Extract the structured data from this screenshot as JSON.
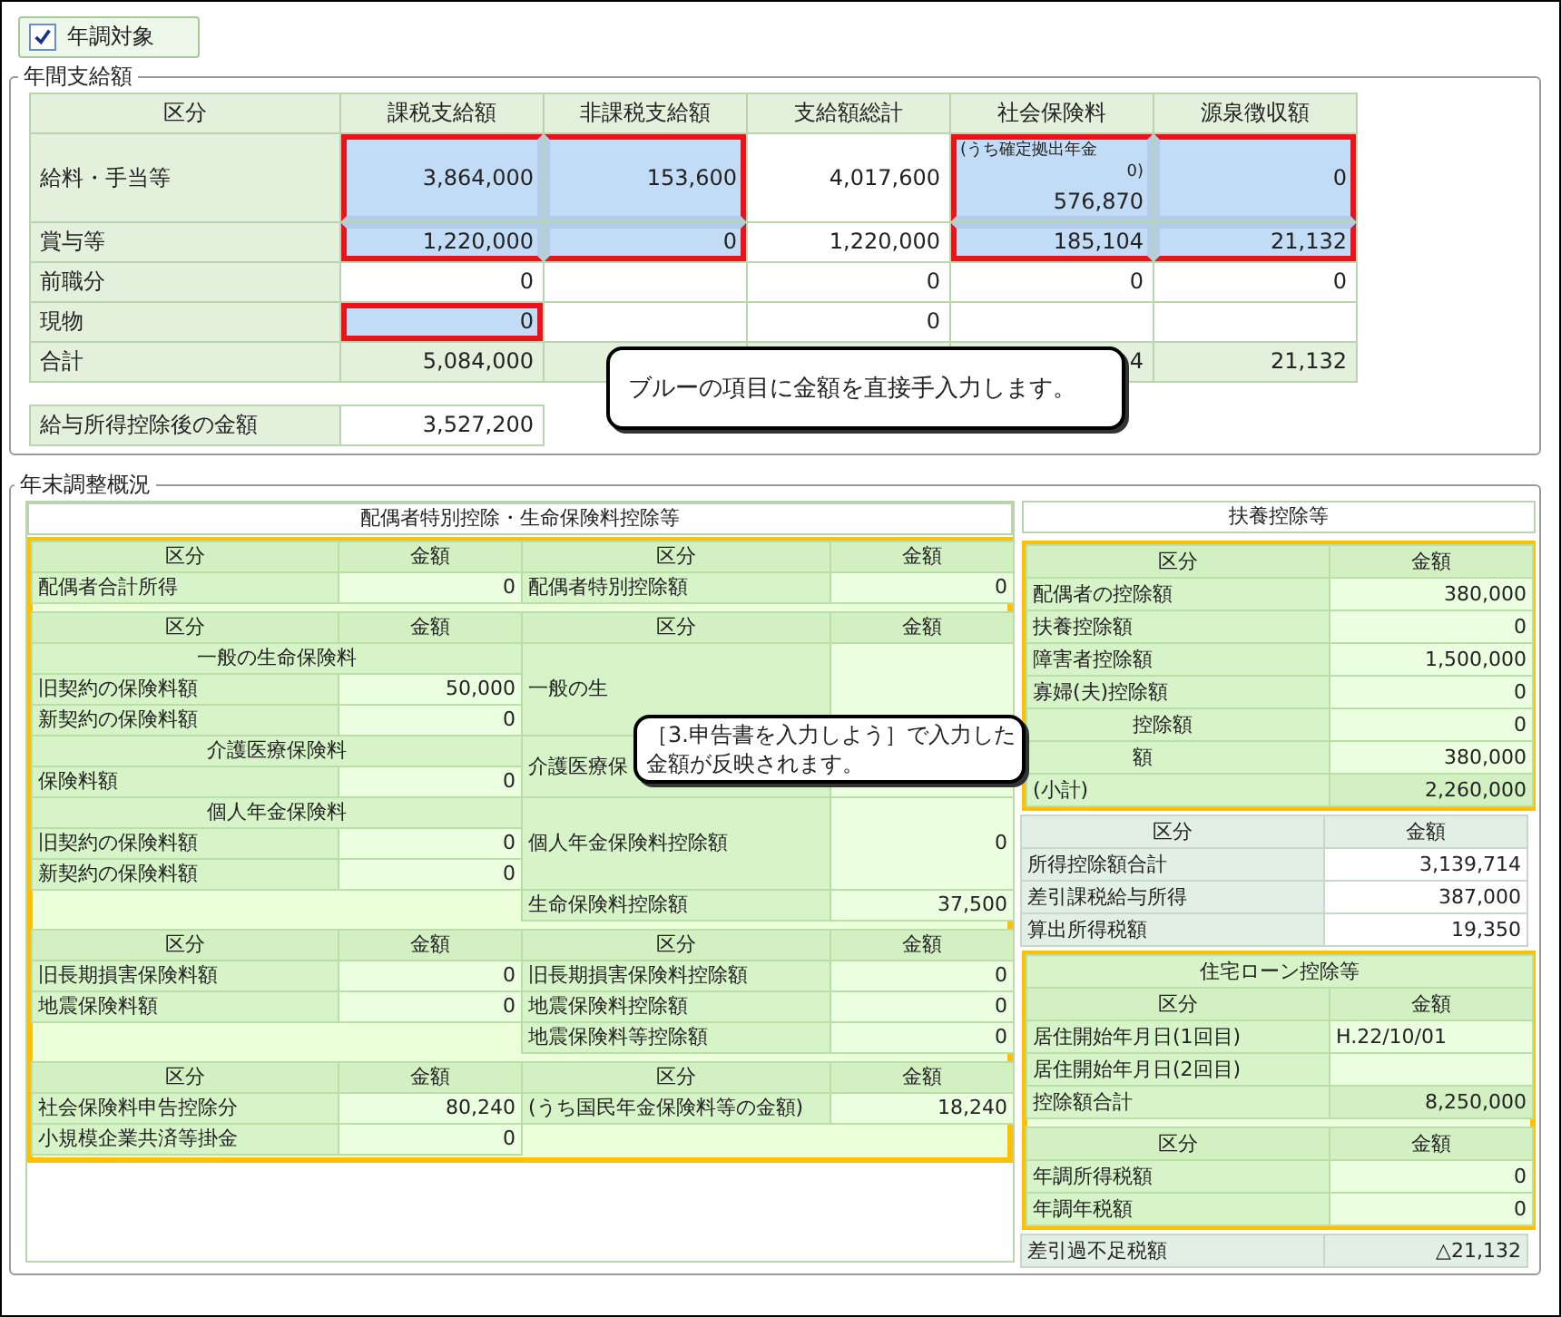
{
  "checkbox": {
    "label": "年調対象",
    "checked": true
  },
  "annual": {
    "legend": "年間支給額",
    "columns": [
      "区分",
      "課税支給額",
      "非課税支給額",
      "支給額総計",
      "社会保険料",
      "源泉徴収額"
    ],
    "rows": [
      {
        "cells": [
          {
            "value": "給料・手当等",
            "kind": "label",
            "highlight": false
          },
          {
            "value": "3,864,000",
            "kind": "input",
            "highlight": true
          },
          {
            "value": "153,600",
            "kind": "input",
            "highlight": true
          },
          {
            "value": "4,017,600",
            "kind": "plain",
            "highlight": false
          },
          {
            "value": "576,870",
            "note": [
              "(うち確定拠出年金",
              "0)"
            ],
            "kind": "input",
            "highlight": true
          },
          {
            "value": "0",
            "kind": "input",
            "highlight": true
          }
        ]
      },
      {
        "cells": [
          {
            "value": "賞与等",
            "kind": "label",
            "highlight": false
          },
          {
            "value": "1,220,000",
            "kind": "input",
            "highlight": true
          },
          {
            "value": "0",
            "kind": "input",
            "highlight": true
          },
          {
            "value": "1,220,000",
            "kind": "plain",
            "highlight": false
          },
          {
            "value": "185,104",
            "kind": "input",
            "highlight": true
          },
          {
            "value": "21,132",
            "kind": "input",
            "highlight": true
          }
        ]
      },
      {
        "cells": [
          {
            "value": "前職分",
            "kind": "label",
            "highlight": false
          },
          {
            "value": "0",
            "kind": "plain",
            "highlight": false
          },
          {
            "kind": "plain",
            "highlight": false
          },
          {
            "value": "0",
            "kind": "plain",
            "highlight": false
          },
          {
            "value": "0",
            "kind": "plain",
            "highlight": false
          },
          {
            "value": "0",
            "kind": "plain",
            "highlight": false
          }
        ]
      },
      {
        "cells": [
          {
            "value": "現物",
            "kind": "label",
            "highlight": false
          },
          {
            "value": "0",
            "kind": "input",
            "highlight": true
          },
          {
            "kind": "plain",
            "highlight": false
          },
          {
            "value": "0",
            "kind": "plain",
            "highlight": false
          },
          {
            "kind": "plain",
            "highlight": false
          },
          {
            "kind": "plain",
            "highlight": false
          }
        ]
      },
      {
        "cells": [
          {
            "value": "合計",
            "kind": "label",
            "highlight": false
          },
          {
            "value": "5,084,000",
            "kind": "total",
            "highlight": false
          },
          {
            "kind": "total",
            "highlight": false
          },
          {
            "kind": "total",
            "highlight": false
          },
          {
            "value": "4",
            "kind": "total",
            "highlight": false
          },
          {
            "value": "21,132",
            "kind": "total",
            "highlight": false
          }
        ]
      }
    ],
    "after_deduction": {
      "label": "給与所得控除後の金額",
      "value": "3,527,200"
    }
  },
  "summary": {
    "legend": "年末調整概況",
    "left": {
      "title": "配偶者特別控除・生命保険料控除等",
      "blocks": [
        {
          "kind": "pairs",
          "headers": [
            "区分",
            "金額",
            "区分",
            "金額"
          ],
          "rows": [
            [
              {
                "label": "配偶者合計所得",
                "value": "0"
              },
              {
                "label": "配偶者特別控除額",
                "value": "0"
              }
            ]
          ]
        },
        {
          "kind": "grouped",
          "headers": [
            "区分",
            "金額",
            "区分",
            "金額"
          ],
          "groups": [
            {
              "title": "一般の生命保険料",
              "items": [
                {
                  "label": "旧契約の保険料額",
                  "value": "50,000"
                },
                {
                  "label": "新契約の保険料額",
                  "value": "0"
                }
              ],
              "deduction": {
                "label": "一般の生"
              }
            },
            {
              "title": "介護医療保険料",
              "items": [
                {
                  "label": "保険料額",
                  "value": "0"
                }
              ],
              "deduction": {
                "label": "介護医療保"
              }
            },
            {
              "title": "個人年金保険料",
              "items": [
                {
                  "label": "旧契約の保険料額",
                  "value": "0"
                },
                {
                  "label": "新契約の保険料額",
                  "value": "0"
                }
              ],
              "deduction": {
                "label": "個人年金保険料控除額",
                "value": "0"
              }
            }
          ],
          "total": {
            "label": "生命保険料控除額",
            "value": "37,500"
          }
        },
        {
          "kind": "pairs",
          "headers": [
            "区分",
            "金額",
            "区分",
            "金額"
          ],
          "rows": [
            [
              {
                "label": "旧長期損害保険料額",
                "value": "0"
              },
              {
                "label": "旧長期損害保険料控除額",
                "value": "0"
              }
            ],
            [
              {
                "label": "地震保険料額",
                "value": "0"
              },
              {
                "label": "地震保険料控除額",
                "value": "0"
              }
            ],
            [
              null,
              {
                "label": "地震保険料等控除額",
                "value": "0"
              }
            ]
          ]
        },
        {
          "kind": "pairs",
          "headers": [
            "区分",
            "金額",
            "区分",
            "金額"
          ],
          "rows": [
            [
              {
                "label": "社会保険料申告控除分",
                "value": "80,240"
              },
              {
                "label": "(うち国民年金保険料等の金額)",
                "value": "18,240"
              }
            ],
            [
              {
                "label": "小規模企業共済等掛金",
                "value": "0"
              },
              null
            ]
          ]
        }
      ]
    },
    "right": {
      "title": "扶養控除等",
      "dependents": {
        "headers": [
          "区分",
          "金額"
        ],
        "rows": [
          {
            "label": "配偶者の控除額",
            "value": "380,000",
            "kind": "normal"
          },
          {
            "label": "扶養控除額",
            "value": "0",
            "kind": "normal"
          },
          {
            "label": "障害者控除額",
            "value": "1,500,000",
            "kind": "normal"
          },
          {
            "label": "寡婦(夫)控除額",
            "value": "0",
            "kind": "normal"
          },
          {
            "label": "控除額",
            "value": "0",
            "kind": "obscured"
          },
          {
            "label": "額",
            "value": "380,000",
            "kind": "obscured"
          },
          {
            "label": "(小計)",
            "value": "2,260,000",
            "kind": "total"
          }
        ]
      },
      "income": {
        "headers": [
          "区分",
          "金額"
        ],
        "rows": [
          {
            "label": "所得控除額合計",
            "value": "3,139,714"
          },
          {
            "label": "差引課税給与所得",
            "value": "387,000"
          },
          {
            "label": "算出所得税額",
            "value": "19,350"
          }
        ]
      },
      "housing": {
        "title": "住宅ローン控除等",
        "headers": [
          "区分",
          "金額"
        ],
        "rows": [
          {
            "label": "居住開始年月日(1回目)",
            "value": "H.22/10/01",
            "kind": "date"
          },
          {
            "label": "居住開始年月日(2回目)",
            "kind": "date"
          },
          {
            "label": "控除額合計",
            "value": "8,250,000",
            "kind": "total"
          }
        ],
        "headers_2": [
          "区分",
          "金額"
        ],
        "rows_2": [
          {
            "label": "年調所得税額",
            "value": "0",
            "kind": "normal"
          },
          {
            "label": "年調年税額",
            "value": "0",
            "kind": "normal"
          }
        ]
      },
      "balance": {
        "label": "差引過不足税額",
        "value": "△21,132"
      }
    }
  },
  "callouts": [
    {
      "lines": [
        "ブルーの項目に金額を直接手入力します。"
      ]
    },
    {
      "lines": [
        "［3.申告書を入力しよう］で入力した",
        "金額が反映されます。"
      ]
    }
  ]
}
